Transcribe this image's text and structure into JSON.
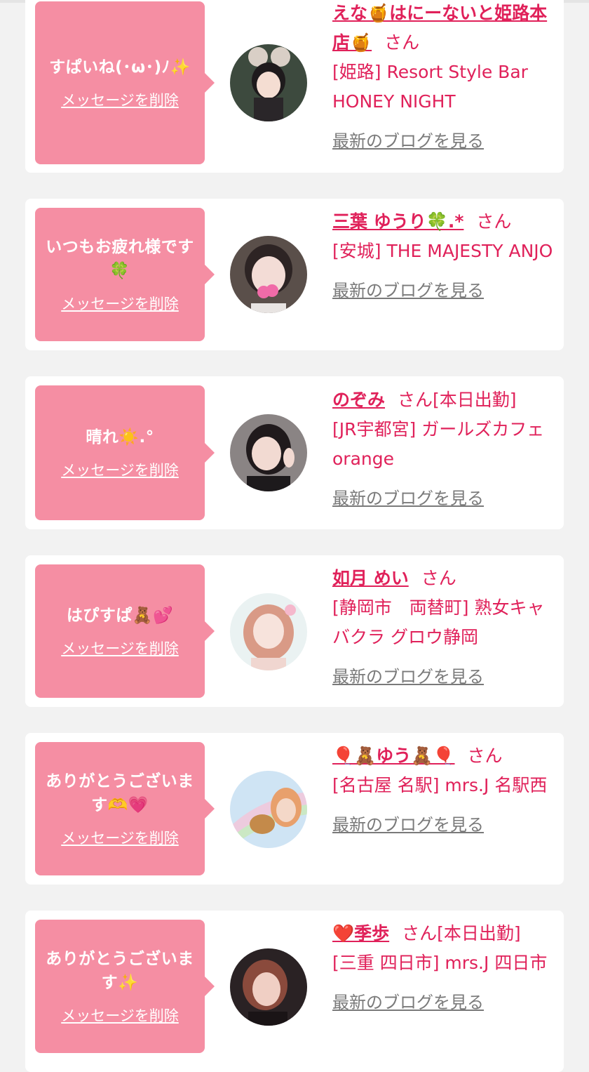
{
  "messages": [
    {
      "message": "すぱいね(･ω･)ﾉ✨",
      "delete_label": "メッセージを削除",
      "name": "えな🍯はにーないと姫路本店🍯",
      "honorific": "さん",
      "work_status": "",
      "store": "[姫路] Resort Style Bar HONEY NIGHT",
      "blog_link": "最新のブログを見る"
    },
    {
      "message": "いつもお疲れ様です🍀",
      "delete_label": "メッセージを削除",
      "name": "三葉 ゆうり🍀.*",
      "honorific": "さん",
      "work_status": "",
      "store": "[安城] THE MAJESTY ANJO",
      "blog_link": "最新のブログを見る"
    },
    {
      "message": "晴れ☀️.°",
      "delete_label": "メッセージを削除",
      "name": "のぞみ",
      "honorific": "さん",
      "work_status": "[本日出勤]",
      "store": "[JR宇都宮] ガールズカフェ orange",
      "blog_link": "最新のブログを見る"
    },
    {
      "message": "はぴすぱ🧸💕",
      "delete_label": "メッセージを削除",
      "name": "如月 めい",
      "honorific": "さん",
      "work_status": "",
      "store": "[静岡市　両替町] 熟女キャバクラ グロウ静岡",
      "blog_link": "最新のブログを見る"
    },
    {
      "message": "ありがとうございます🫶💗",
      "delete_label": "メッセージを削除",
      "name": "🎈🧸ゆう🧸🎈",
      "honorific": "さん",
      "work_status": "",
      "store": "[名古屋 名駅] mrs.J 名駅西",
      "blog_link": "最新のブログを見る"
    },
    {
      "message": "ありがとうございます✨",
      "delete_label": "メッセージを削除",
      "name": "❤️季歩",
      "honorific": "さん",
      "work_status": "[本日出勤]",
      "store": "[三重 四日市] mrs.J 四日市",
      "blog_link": "最新のブログを見る"
    }
  ],
  "colors": {
    "bubble": "#f58ea3",
    "accent": "#e0215a",
    "link_gray": "#7a7a7a",
    "background": "#f2f2f2"
  }
}
